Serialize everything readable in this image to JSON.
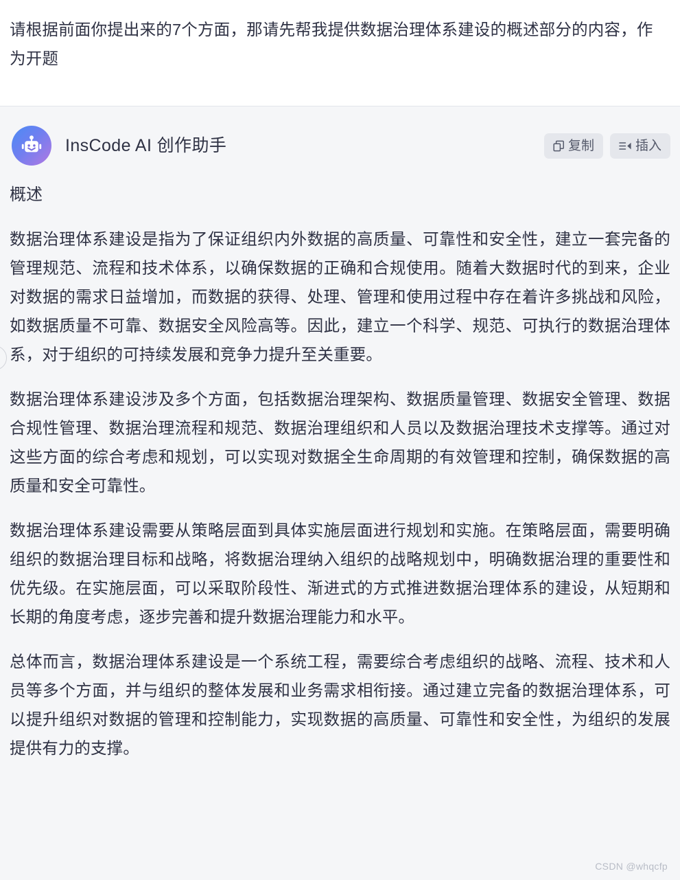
{
  "user_message": {
    "text": "请根据前面你提出来的7个方面，那请先帮我提供数据治理体系建设的概述部分的内容，作为开题"
  },
  "assistant": {
    "name": "InsCode AI 创作助手",
    "avatar_icon": "robot-icon",
    "avatar_gradient_from": "#4b8bf4",
    "avatar_gradient_to": "#b278e2",
    "actions": [
      {
        "label": "复制",
        "icon": "copy-icon"
      },
      {
        "label": "插入",
        "icon": "insert-icon"
      }
    ],
    "content": {
      "heading": "概述",
      "paragraphs": [
        "数据治理体系建设是指为了保证组织内外数据的高质量、可靠性和安全性，建立一套完备的管理规范、流程和技术体系，以确保数据的正确和合规使用。随着大数据时代的到来，企业对数据的需求日益增加，而数据的获得、处理、管理和使用过程中存在着许多挑战和风险，如数据质量不可靠、数据安全风险高等。因此，建立一个科学、规范、可执行的数据治理体系，对于组织的可持续发展和竞争力提升至关重要。",
        "数据治理体系建设涉及多个方面，包括数据治理架构、数据质量管理、数据安全管理、数据合规性管理、数据治理流程和规范、数据治理组织和人员以及数据治理技术支撑等。通过对这些方面的综合考虑和规划，可以实现对数据全生命周期的有效管理和控制，确保数据的高质量和安全可靠性。",
        "数据治理体系建设需要从策略层面到具体实施层面进行规划和实施。在策略层面，需要明确组织的数据治理目标和战略，将数据治理纳入组织的战略规划中，明确数据治理的重要性和优先级。在实施层面，可以采取阶段性、渐进式的方式推进数据治理体系的建设，从短期和长期的角度考虑，逐步完善和提升数据治理能力和水平。",
        "总体而言，数据治理体系建设是一个系统工程，需要综合考虑组织的战略、流程、技术和人员等多个方面，并与组织的整体发展和业务需求相衔接。通过建立完备的数据治理体系，可以提升组织对数据的管理和控制能力，实现数据的高质量、可靠性和安全性，为组织的发展提供有力的支撑。"
      ]
    }
  },
  "watermark": {
    "text": "CSDN @whqcfp"
  }
}
